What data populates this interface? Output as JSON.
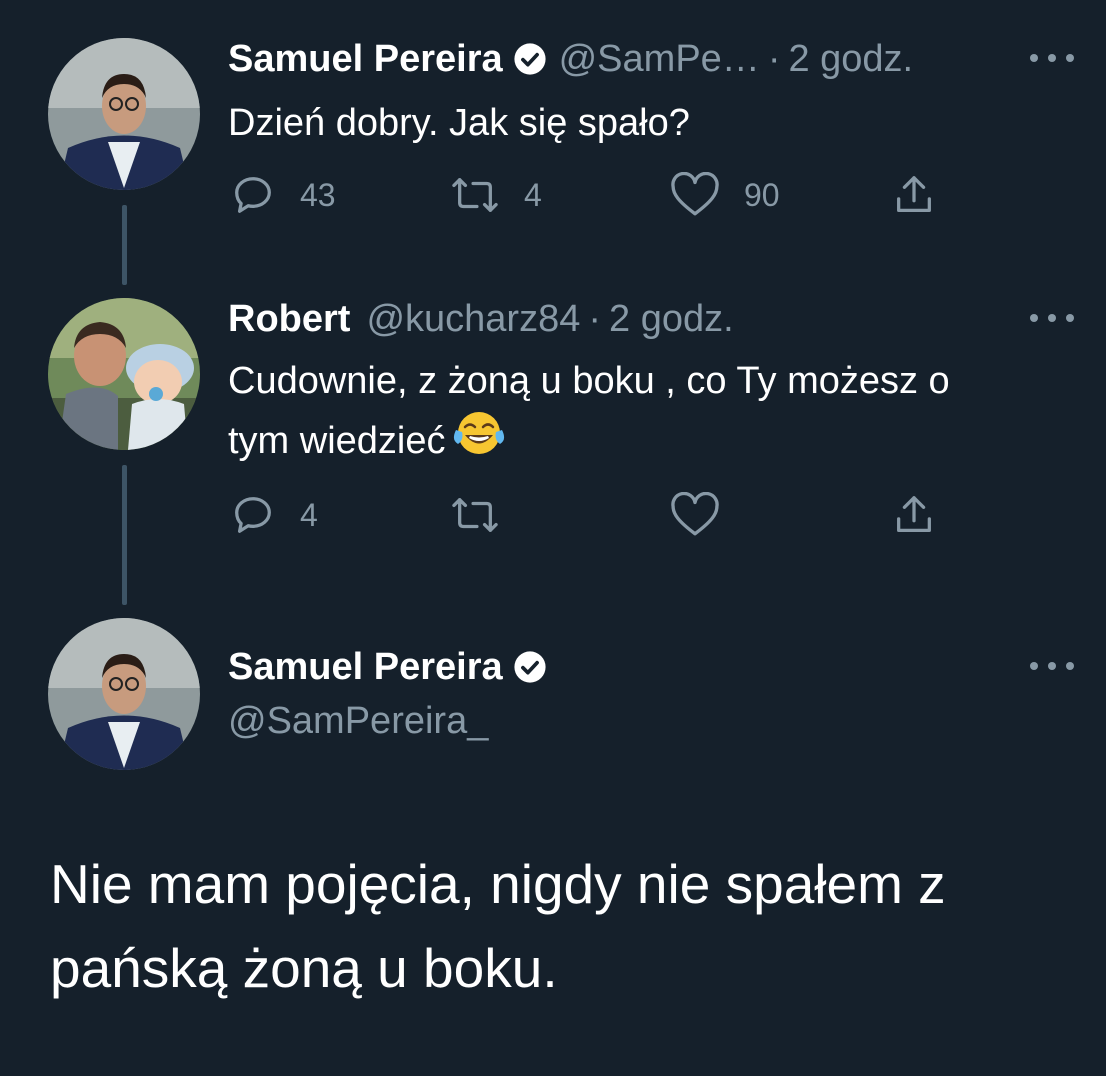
{
  "tweets": [
    {
      "name": "Samuel Pereira",
      "handle": "@SamPe…",
      "separator": "·",
      "time": "2 godz.",
      "text": "Dzień dobry. Jak się spało?",
      "replies": "43",
      "retweets": "4",
      "likes": "90",
      "avatar": "man-with-glasses-avatar"
    },
    {
      "name": "Robert",
      "handle": "@kucharz84",
      "separator": "·",
      "time": "2 godz.",
      "text_line1": "Cudownie, z żoną u boku , co Ty możesz o",
      "text_line2": "tym wiedzieć",
      "emoji": "tears-of-joy-emoji",
      "replies": "4",
      "avatar": "man-with-baby-avatar"
    }
  ],
  "main_tweet": {
    "name": "Samuel Pereira",
    "handle": "@SamPereira_",
    "text_line1": "Nie mam pojęcia, nigdy nie spałem z",
    "text_line2": "pańską żoną u boku.",
    "avatar": "man-with-glasses-avatar"
  },
  "colors": {
    "background": "#15202b",
    "text": "#ffffff",
    "muted": "#8899a6",
    "thread_line": "#3d5466"
  }
}
